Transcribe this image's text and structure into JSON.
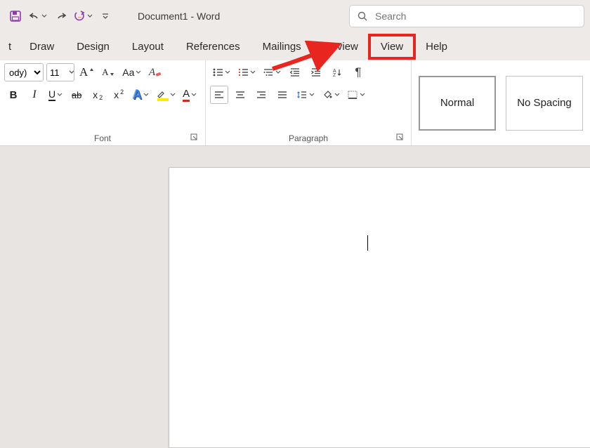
{
  "titlebar": {
    "doc_title": "Document1  -  Word"
  },
  "search": {
    "placeholder": "Search"
  },
  "tabs": {
    "items": [
      {
        "key": "t",
        "label": "t"
      },
      {
        "key": "draw",
        "label": "Draw"
      },
      {
        "key": "design",
        "label": "Design"
      },
      {
        "key": "layout",
        "label": "Layout"
      },
      {
        "key": "references",
        "label": "References"
      },
      {
        "key": "mailings",
        "label": "Mailings"
      },
      {
        "key": "review",
        "label": "Review"
      },
      {
        "key": "view",
        "label": "View"
      },
      {
        "key": "help",
        "label": "Help"
      }
    ]
  },
  "font": {
    "group_label": "Font",
    "family_value": "ody)",
    "size_value": "11",
    "increase_A": "A",
    "decrease_A": "A",
    "changecase_Aa": "Aa",
    "clearfmt_A": "A",
    "bold_B": "B",
    "italic_I": "I",
    "underline_U": "U",
    "strike_ab": "ab",
    "sub_x": "x",
    "sub_2": "2",
    "sup_x": "x",
    "sup_2": "2",
    "effects_A": "A",
    "highlight_A": "A",
    "color_A": "A"
  },
  "paragraph": {
    "group_label": "Paragraph",
    "pilcrow": "¶"
  },
  "styles": {
    "items": [
      {
        "label": "Normal",
        "selected": true
      },
      {
        "label": "No Spacing",
        "selected": false
      }
    ]
  }
}
